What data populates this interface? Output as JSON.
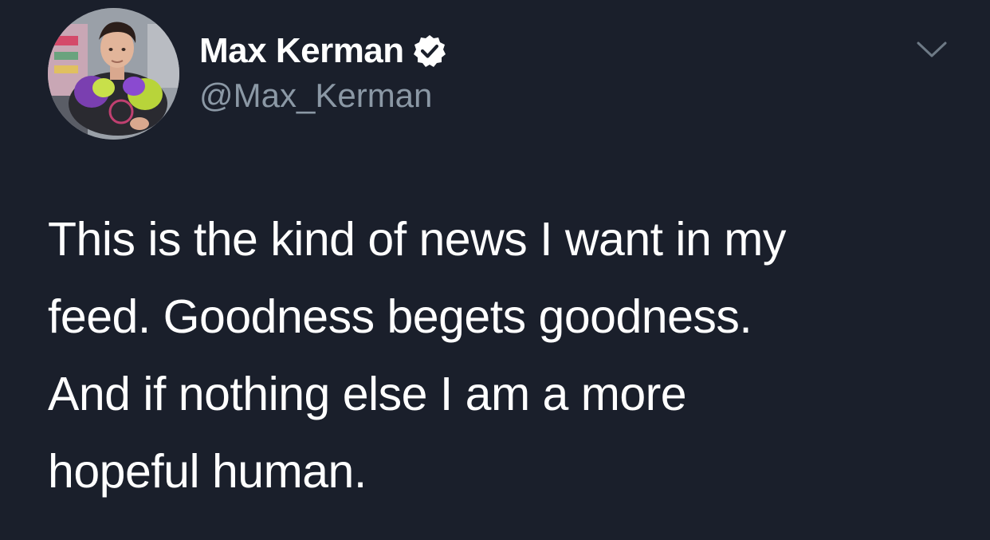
{
  "author": {
    "display_name": "Max Kerman",
    "handle": "@Max_Kerman",
    "verified": true,
    "avatar_icon": "profile-photo"
  },
  "tweet": {
    "lines": [
      "This is the kind of news I want in my",
      "feed. Goodness begets goodness.",
      "And if nothing else I am a more",
      "hopeful human."
    ]
  },
  "icons": {
    "verified": "verified-badge-icon",
    "menu": "chevron-down-icon"
  },
  "colors": {
    "background": "#1a1f2b",
    "text": "#ffffff",
    "handle": "#8b98a5"
  }
}
